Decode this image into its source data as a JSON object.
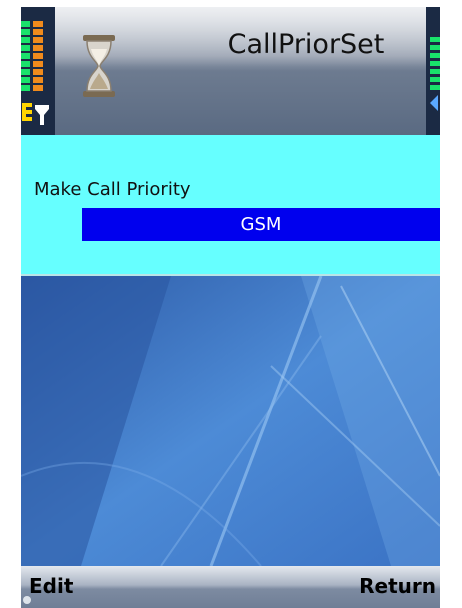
{
  "window": {
    "title": "CallPriorSet"
  },
  "content": {
    "field_label": "Make Call Priority",
    "selected_value": "GSM"
  },
  "softkeys": {
    "left": "Edit",
    "right": "Return"
  },
  "colors": {
    "panel_bg": "#66ffff",
    "selection_bg": "#0000ee",
    "selection_text": "#ffffff"
  },
  "icons": {
    "status_left": "signal-strength-icon",
    "status_right": "battery-icon",
    "busy": "hourglass-icon"
  }
}
